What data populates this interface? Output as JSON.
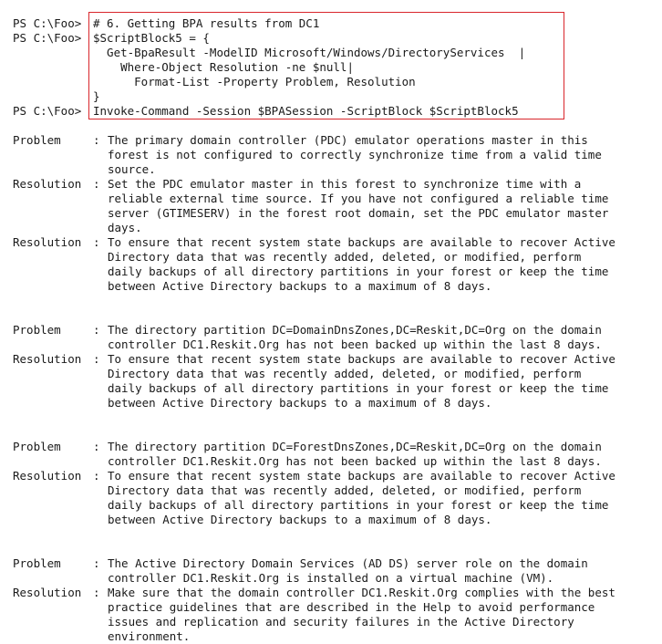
{
  "prompt": "PS C:\\Foo>",
  "code_lines": [
    "# 6. Getting BPA results from DC1",
    "$ScriptBlock5 = {",
    "  Get-BpaResult -ModelID Microsoft/Windows/DirectoryServices  |",
    "    Where-Object Resolution -ne $null|",
    "      Format-List -Property Problem, Resolution",
    "}"
  ],
  "command_line": "Invoke-Command -Session $BPASession -ScriptBlock $ScriptBlock5",
  "results": [
    {
      "problem_label": "Problem",
      "problem": [
        "The primary domain controller (PDC) emulator operations master in this",
        "forest is not configured to correctly synchronize time from a valid time",
        "source."
      ],
      "resolution_label": "Resolution",
      "resolution": [
        "Set the PDC emulator master in this forest to synchronize time with a",
        "reliable external time source. If you have not configured a reliable time",
        "server (GTIMESERV) in the forest root domain, set the PDC emulator master",
        "days."
      ]
    },
    {
      "problem_label": "",
      "problem": [],
      "resolution_label": "Resolution",
      "resolution": [
        "To ensure that recent system state backups are available to recover Active",
        "Directory data that was recently added, deleted, or modified, perform",
        "daily backups of all directory partitions in your forest or keep the time",
        "between Active Directory backups to a maximum of 8 days."
      ]
    },
    {
      "problem_label": "Problem",
      "problem": [
        "The directory partition DC=DomainDnsZones,DC=Reskit,DC=Org on the domain",
        "controller DC1.Reskit.Org has not been backed up within the last 8 days."
      ],
      "resolution_label": "Resolution",
      "resolution": [
        "To ensure that recent system state backups are available to recover Active",
        "Directory data that was recently added, deleted, or modified, perform",
        "daily backups of all directory partitions in your forest or keep the time",
        "between Active Directory backups to a maximum of 8 days."
      ]
    },
    {
      "problem_label": "Problem",
      "problem": [
        "The directory partition DC=ForestDnsZones,DC=Reskit,DC=Org on the domain",
        "controller DC1.Reskit.Org has not been backed up within the last 8 days."
      ],
      "resolution_label": "Resolution",
      "resolution": [
        "To ensure that recent system state backups are available to recover Active",
        "Directory data that was recently added, deleted, or modified, perform",
        "daily backups of all directory partitions in your forest or keep the time",
        "between Active Directory backups to a maximum of 8 days."
      ]
    },
    {
      "problem_label": "Problem",
      "problem": [
        "The Active Directory Domain Services (AD DS) server role on the domain",
        "controller DC1.Reskit.Org is installed on a virtual machine (VM)."
      ],
      "resolution_label": "Resolution",
      "resolution": [
        "Make sure that the domain controller DC1.Reskit.Org complies with the best",
        "practice guidelines that are described in the Help to avoid performance",
        "issues and replication and security failures in the Active Directory",
        "environment."
      ]
    }
  ]
}
